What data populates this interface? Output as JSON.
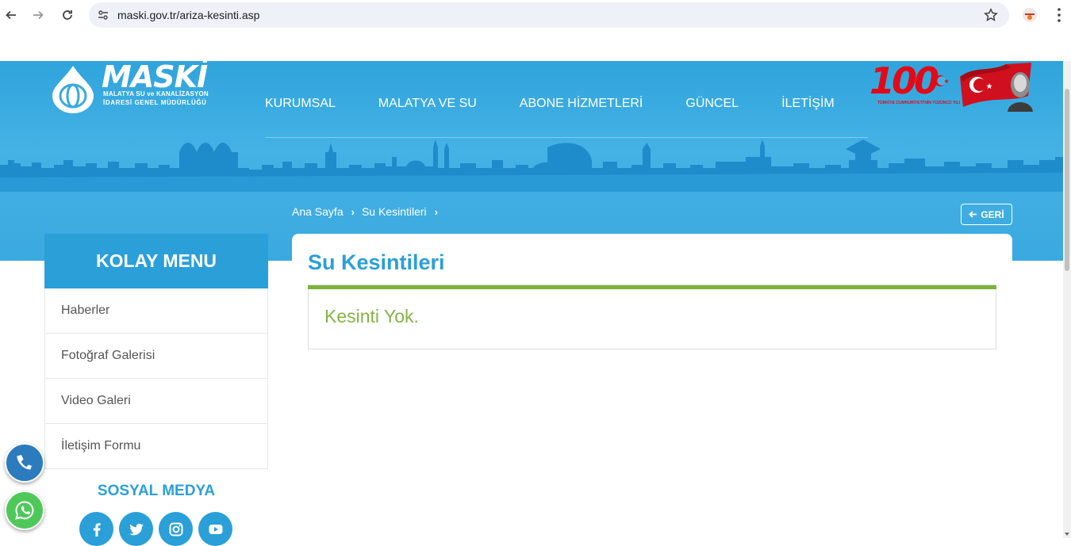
{
  "browser": {
    "url": "maski.gov.tr/ariza-kesinti.asp"
  },
  "header": {
    "logo": {
      "brand": "MASKİ",
      "subtitle_line1": "MALATYA SU ve KANALİZASYON",
      "subtitle_line2": "İDARESİ GENEL MÜDÜRLÜĞÜ"
    },
    "nav": [
      {
        "label": "KURUMSAL"
      },
      {
        "label": "MALATYA VE SU"
      },
      {
        "label": "ABONE HİZMETLERİ"
      },
      {
        "label": "GÜNCEL"
      },
      {
        "label": "İLETİŞİM"
      }
    ],
    "centennial": {
      "number": "100",
      "caption": "TÜRKİYE CUMHURİYETİ'NİN YÜZÜNCÜ YILI"
    }
  },
  "breadcrumb": [
    {
      "label": "Ana Sayfa"
    },
    {
      "label": "Su Kesintileri"
    }
  ],
  "back_button": {
    "label": "GERİ"
  },
  "sidebar": {
    "title": "KOLAY MENU",
    "items": [
      {
        "label": "Haberler"
      },
      {
        "label": "Fotoğraf Galerisi"
      },
      {
        "label": "Video Galeri"
      },
      {
        "label": "İletişim Formu"
      }
    ],
    "social_title": "SOSYAL MEDYA",
    "social_icons": [
      "facebook-icon",
      "twitter-icon",
      "instagram-icon",
      "youtube-icon"
    ]
  },
  "content": {
    "title": "Su Kesintileri",
    "message": "Kesinti Yok."
  },
  "colors": {
    "primary_blue": "#2b9fd8",
    "hero_blue": "#45b2e5",
    "notice_green": "#7db23c",
    "flag_red": "#e30a17",
    "whatsapp_green": "#4ec959"
  }
}
